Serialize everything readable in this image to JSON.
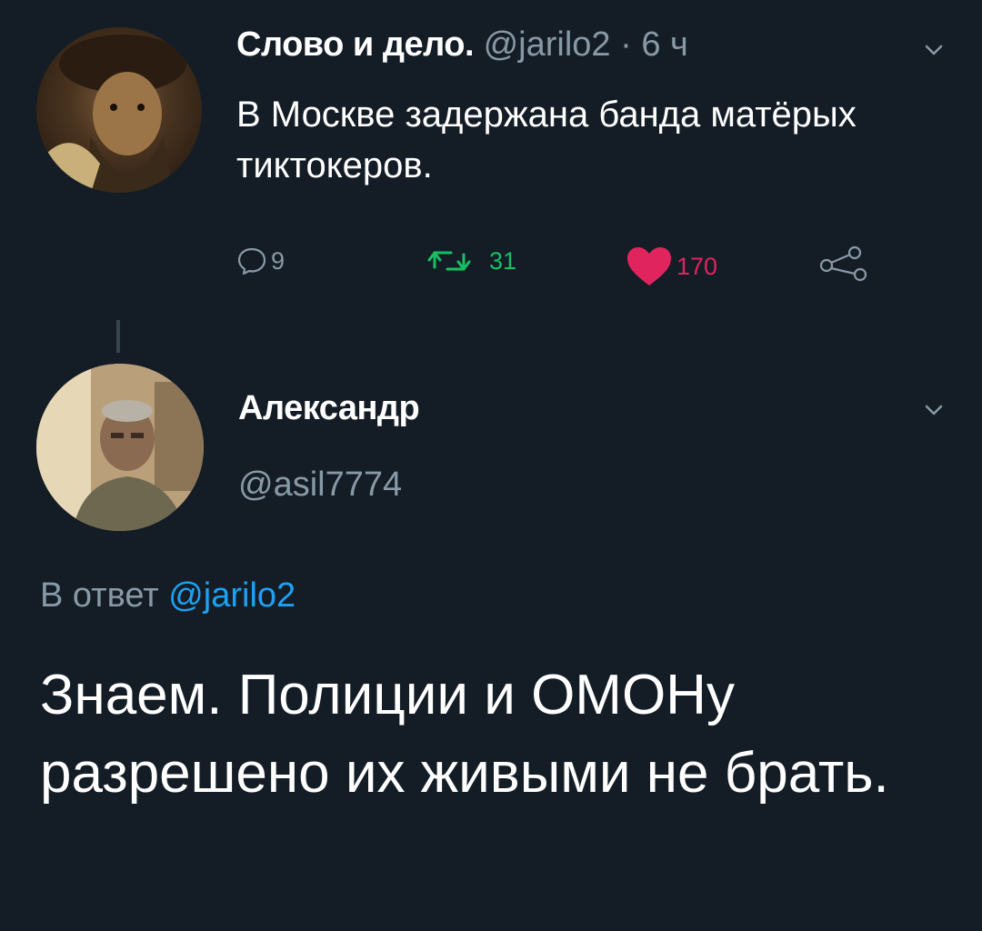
{
  "tweet1": {
    "author_name": "Слово и дело.",
    "handle": "@jarilo2",
    "separator": "·",
    "time": "6 ч",
    "text": "В Москве задержана банда матёрых тиктокеров.",
    "reply_count": "9",
    "retweet_count": "31",
    "like_count": "170"
  },
  "tweet2": {
    "author_name": "Александр",
    "handle": "@asil7774",
    "reply_prefix": "В ответ",
    "reply_to": "@jarilo2",
    "text": "Знаем. Полиции и ОМОНу разрешено их живыми не брать."
  },
  "icons": {
    "reply": "reply-icon",
    "retweet": "retweet-icon",
    "like": "heart-icon",
    "share": "share-icon",
    "menu": "chevron-down-icon"
  },
  "colors": {
    "background": "#141d26",
    "muted": "#8899a6",
    "retweet": "#17bf63",
    "like": "#e0245e",
    "link": "#1da1f2"
  }
}
